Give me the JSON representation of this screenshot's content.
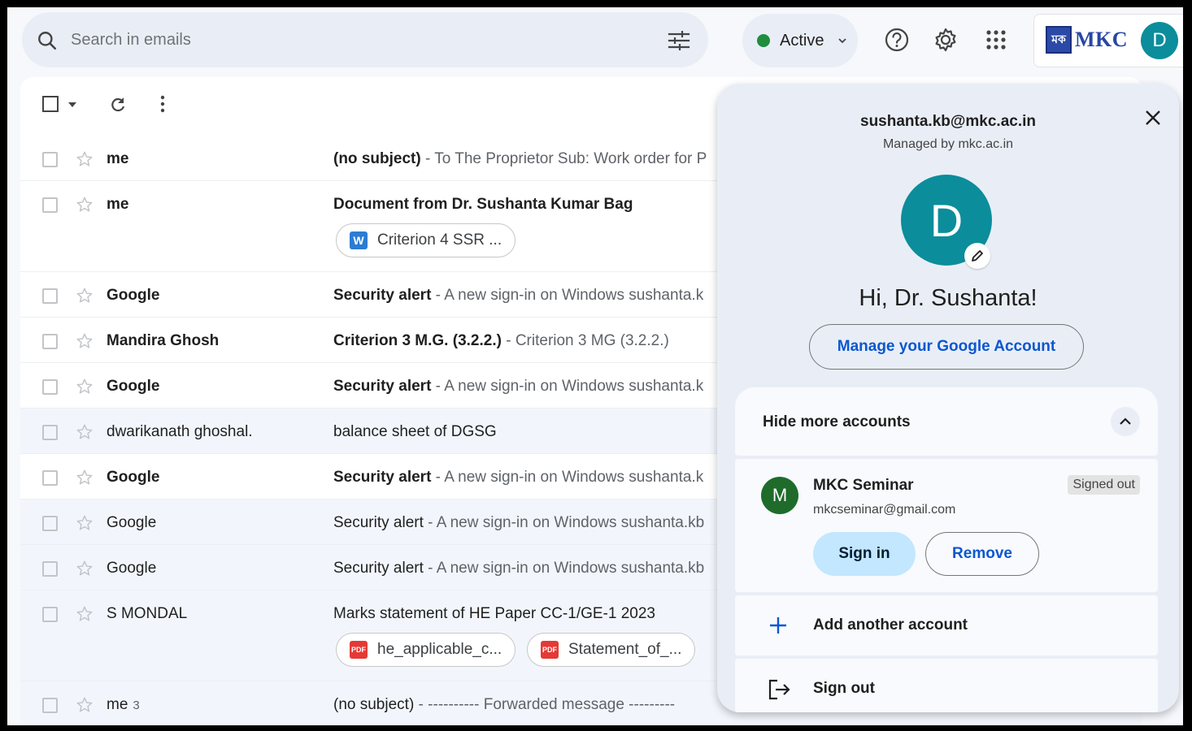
{
  "search": {
    "placeholder": "Search in emails"
  },
  "status": {
    "label": "Active",
    "color": "#1e8e3e"
  },
  "org": {
    "logo_text": "MKC",
    "logo_badge": "মক"
  },
  "user": {
    "initial": "D",
    "avatar_color": "#0b8d9c"
  },
  "emails": [
    {
      "sender": "me",
      "count": "",
      "subject": "(no subject)",
      "snippet": " - To The Proprietor Sub: Work order for P",
      "unread": true,
      "attachments": []
    },
    {
      "sender": "me",
      "count": "",
      "subject": "Document from Dr. Sushanta Kumar Bag",
      "snippet": "",
      "unread": true,
      "attachments": [
        {
          "name": "Criterion 4 SSR ...",
          "type": "W"
        }
      ]
    },
    {
      "sender": "Google",
      "count": "",
      "subject": "Security alert",
      "snippet": " - A new sign-in on Windows sushanta.k",
      "unread": true,
      "attachments": []
    },
    {
      "sender": "Mandira Ghosh",
      "count": "",
      "subject": "Criterion 3 M.G. (3.2.2.)",
      "snippet": " - Criterion 3 MG (3.2.2.)",
      "unread": true,
      "attachments": []
    },
    {
      "sender": "Google",
      "count": "",
      "subject": "Security alert",
      "snippet": " - A new sign-in on Windows sushanta.k",
      "unread": true,
      "attachments": []
    },
    {
      "sender": "dwarikanath ghoshal.",
      "count": "",
      "subject": "balance sheet of DGSG",
      "snippet": "",
      "unread": false,
      "attachments": []
    },
    {
      "sender": "Google",
      "count": "",
      "subject": "Security alert",
      "snippet": " - A new sign-in on Windows sushanta.k",
      "unread": true,
      "attachments": []
    },
    {
      "sender": "Google",
      "count": "",
      "subject": "Security alert",
      "snippet": " - A new sign-in on Windows sushanta.kb",
      "unread": false,
      "attachments": []
    },
    {
      "sender": "Google",
      "count": "",
      "subject": "Security alert",
      "snippet": " - A new sign-in on Windows sushanta.kb",
      "unread": false,
      "attachments": []
    },
    {
      "sender": "S MONDAL",
      "count": "",
      "subject": "Marks statement of HE Paper CC-1/GE-1 2023",
      "snippet": "",
      "unread": false,
      "attachments": [
        {
          "name": "he_applicable_c...",
          "type": "PDF"
        },
        {
          "name": "Statement_of_...",
          "type": "PDF"
        }
      ]
    },
    {
      "sender": "me",
      "count": "3",
      "subject": "(no subject)",
      "snippet": " - ---------- Forwarded message ---------",
      "unread": false,
      "attachments": []
    }
  ],
  "account_panel": {
    "email": "sushanta.kb@mkc.ac.in",
    "managed_by": "Managed by mkc.ac.in",
    "initial": "D",
    "greeting": "Hi, Dr. Sushanta!",
    "manage_label": "Manage your Google Account",
    "hide_more_label": "Hide more accounts",
    "other_account": {
      "initial": "M",
      "name": "MKC Seminar",
      "email": "mkcseminar@gmail.com",
      "status": "Signed out",
      "signin_label": "Sign in",
      "remove_label": "Remove"
    },
    "add_account_label": "Add another account",
    "sign_out_label": "Sign out"
  }
}
